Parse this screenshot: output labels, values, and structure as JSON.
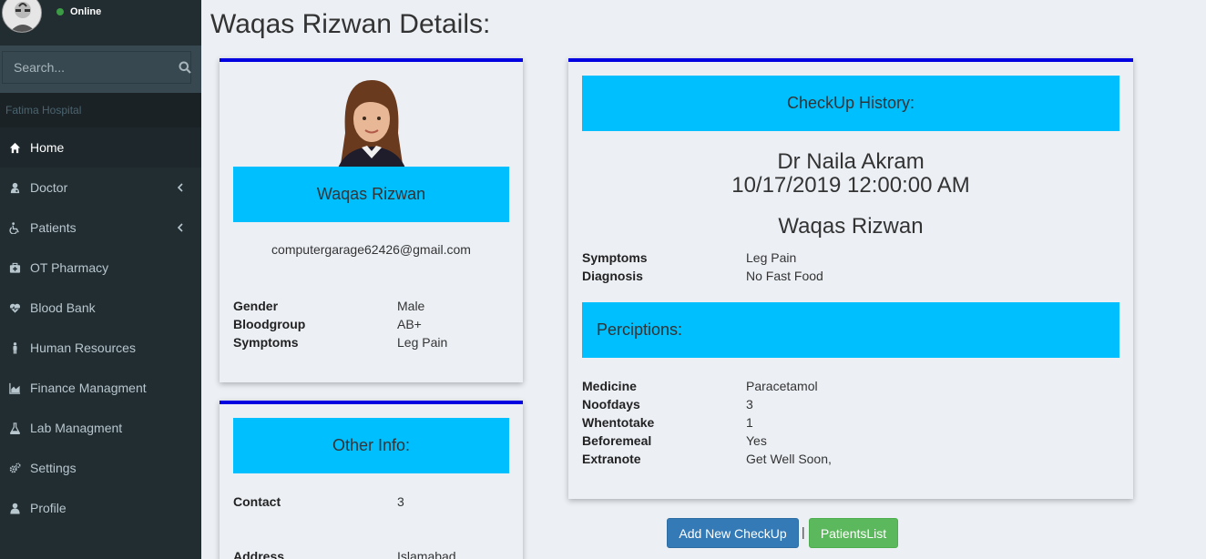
{
  "user": {
    "status": "Online"
  },
  "search": {
    "placeholder": "Search..."
  },
  "sidebar": {
    "section_label": "Fatima Hospital",
    "items": [
      {
        "label": "Home"
      },
      {
        "label": "Doctor"
      },
      {
        "label": "Patients"
      },
      {
        "label": "OT Pharmacy"
      },
      {
        "label": "Blood Bank"
      },
      {
        "label": "Human Resources"
      },
      {
        "label": "Finance Managment"
      },
      {
        "label": "Lab Managment"
      },
      {
        "label": "Settings"
      },
      {
        "label": "Profile"
      }
    ]
  },
  "page": {
    "title": "Waqas Rizwan Details:"
  },
  "patient_card": {
    "name": "Waqas Rizwan",
    "email": "computergarage62426@gmail.com",
    "fields": [
      {
        "label": "Gender",
        "value": "Male"
      },
      {
        "label": "Bloodgroup",
        "value": "AB+"
      },
      {
        "label": "Symptoms",
        "value": "Leg Pain"
      }
    ]
  },
  "other_info": {
    "title": "Other Info:",
    "fields": [
      {
        "label": "Contact",
        "value": "3"
      },
      {
        "label": "Address",
        "value": "Islamabad"
      }
    ]
  },
  "checkup": {
    "title": "CheckUp History:",
    "doctor": "Dr Naila Akram",
    "datetime": "10/17/2019 12:00:00 AM",
    "patient": "Waqas Rizwan",
    "fields": [
      {
        "label": "Symptoms",
        "value": "Leg Pain"
      },
      {
        "label": "Diagnosis",
        "value": "No Fast Food"
      }
    ],
    "prescriptions_title": "Perciptions:",
    "prescription_fields": [
      {
        "label": "Medicine",
        "value": "Paracetamol"
      },
      {
        "label": "Noofdays",
        "value": "3"
      },
      {
        "label": "Whentotake",
        "value": "1"
      },
      {
        "label": "Beforemeal",
        "value": "Yes"
      },
      {
        "label": "Extranote",
        "value": "Get Well Soon,"
      }
    ]
  },
  "actions": {
    "add_checkup": "Add New CheckUp",
    "separator": "|",
    "patients_list": "PatientsList"
  },
  "colors": {
    "sidebar_bg": "#222d32",
    "banner": "#00bfff",
    "card_border": "#0000e0",
    "primary_button": "#337ab7",
    "success_button": "#5cb85c"
  }
}
